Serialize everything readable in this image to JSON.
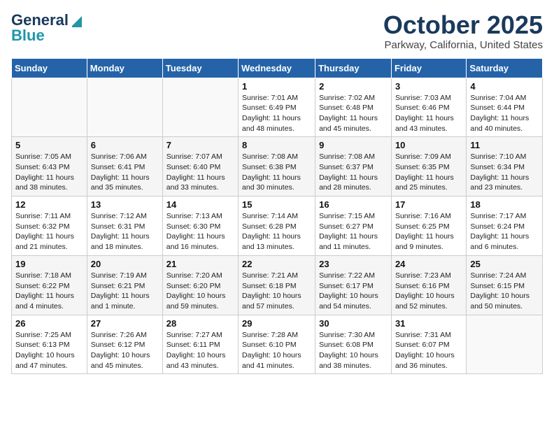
{
  "header": {
    "logo_general": "General",
    "logo_blue": "Blue",
    "month": "October 2025",
    "location": "Parkway, California, United States"
  },
  "days_of_week": [
    "Sunday",
    "Monday",
    "Tuesday",
    "Wednesday",
    "Thursday",
    "Friday",
    "Saturday"
  ],
  "weeks": [
    [
      {
        "day": "",
        "info": ""
      },
      {
        "day": "",
        "info": ""
      },
      {
        "day": "",
        "info": ""
      },
      {
        "day": "1",
        "info": "Sunrise: 7:01 AM\nSunset: 6:49 PM\nDaylight: 11 hours\nand 48 minutes."
      },
      {
        "day": "2",
        "info": "Sunrise: 7:02 AM\nSunset: 6:48 PM\nDaylight: 11 hours\nand 45 minutes."
      },
      {
        "day": "3",
        "info": "Sunrise: 7:03 AM\nSunset: 6:46 PM\nDaylight: 11 hours\nand 43 minutes."
      },
      {
        "day": "4",
        "info": "Sunrise: 7:04 AM\nSunset: 6:44 PM\nDaylight: 11 hours\nand 40 minutes."
      }
    ],
    [
      {
        "day": "5",
        "info": "Sunrise: 7:05 AM\nSunset: 6:43 PM\nDaylight: 11 hours\nand 38 minutes."
      },
      {
        "day": "6",
        "info": "Sunrise: 7:06 AM\nSunset: 6:41 PM\nDaylight: 11 hours\nand 35 minutes."
      },
      {
        "day": "7",
        "info": "Sunrise: 7:07 AM\nSunset: 6:40 PM\nDaylight: 11 hours\nand 33 minutes."
      },
      {
        "day": "8",
        "info": "Sunrise: 7:08 AM\nSunset: 6:38 PM\nDaylight: 11 hours\nand 30 minutes."
      },
      {
        "day": "9",
        "info": "Sunrise: 7:08 AM\nSunset: 6:37 PM\nDaylight: 11 hours\nand 28 minutes."
      },
      {
        "day": "10",
        "info": "Sunrise: 7:09 AM\nSunset: 6:35 PM\nDaylight: 11 hours\nand 25 minutes."
      },
      {
        "day": "11",
        "info": "Sunrise: 7:10 AM\nSunset: 6:34 PM\nDaylight: 11 hours\nand 23 minutes."
      }
    ],
    [
      {
        "day": "12",
        "info": "Sunrise: 7:11 AM\nSunset: 6:32 PM\nDaylight: 11 hours\nand 21 minutes."
      },
      {
        "day": "13",
        "info": "Sunrise: 7:12 AM\nSunset: 6:31 PM\nDaylight: 11 hours\nand 18 minutes."
      },
      {
        "day": "14",
        "info": "Sunrise: 7:13 AM\nSunset: 6:30 PM\nDaylight: 11 hours\nand 16 minutes."
      },
      {
        "day": "15",
        "info": "Sunrise: 7:14 AM\nSunset: 6:28 PM\nDaylight: 11 hours\nand 13 minutes."
      },
      {
        "day": "16",
        "info": "Sunrise: 7:15 AM\nSunset: 6:27 PM\nDaylight: 11 hours\nand 11 minutes."
      },
      {
        "day": "17",
        "info": "Sunrise: 7:16 AM\nSunset: 6:25 PM\nDaylight: 11 hours\nand 9 minutes."
      },
      {
        "day": "18",
        "info": "Sunrise: 7:17 AM\nSunset: 6:24 PM\nDaylight: 11 hours\nand 6 minutes."
      }
    ],
    [
      {
        "day": "19",
        "info": "Sunrise: 7:18 AM\nSunset: 6:22 PM\nDaylight: 11 hours\nand 4 minutes."
      },
      {
        "day": "20",
        "info": "Sunrise: 7:19 AM\nSunset: 6:21 PM\nDaylight: 11 hours\nand 1 minute."
      },
      {
        "day": "21",
        "info": "Sunrise: 7:20 AM\nSunset: 6:20 PM\nDaylight: 10 hours\nand 59 minutes."
      },
      {
        "day": "22",
        "info": "Sunrise: 7:21 AM\nSunset: 6:18 PM\nDaylight: 10 hours\nand 57 minutes."
      },
      {
        "day": "23",
        "info": "Sunrise: 7:22 AM\nSunset: 6:17 PM\nDaylight: 10 hours\nand 54 minutes."
      },
      {
        "day": "24",
        "info": "Sunrise: 7:23 AM\nSunset: 6:16 PM\nDaylight: 10 hours\nand 52 minutes."
      },
      {
        "day": "25",
        "info": "Sunrise: 7:24 AM\nSunset: 6:15 PM\nDaylight: 10 hours\nand 50 minutes."
      }
    ],
    [
      {
        "day": "26",
        "info": "Sunrise: 7:25 AM\nSunset: 6:13 PM\nDaylight: 10 hours\nand 47 minutes."
      },
      {
        "day": "27",
        "info": "Sunrise: 7:26 AM\nSunset: 6:12 PM\nDaylight: 10 hours\nand 45 minutes."
      },
      {
        "day": "28",
        "info": "Sunrise: 7:27 AM\nSunset: 6:11 PM\nDaylight: 10 hours\nand 43 minutes."
      },
      {
        "day": "29",
        "info": "Sunrise: 7:28 AM\nSunset: 6:10 PM\nDaylight: 10 hours\nand 41 minutes."
      },
      {
        "day": "30",
        "info": "Sunrise: 7:30 AM\nSunset: 6:08 PM\nDaylight: 10 hours\nand 38 minutes."
      },
      {
        "day": "31",
        "info": "Sunrise: 7:31 AM\nSunset: 6:07 PM\nDaylight: 10 hours\nand 36 minutes."
      },
      {
        "day": "",
        "info": ""
      }
    ]
  ]
}
